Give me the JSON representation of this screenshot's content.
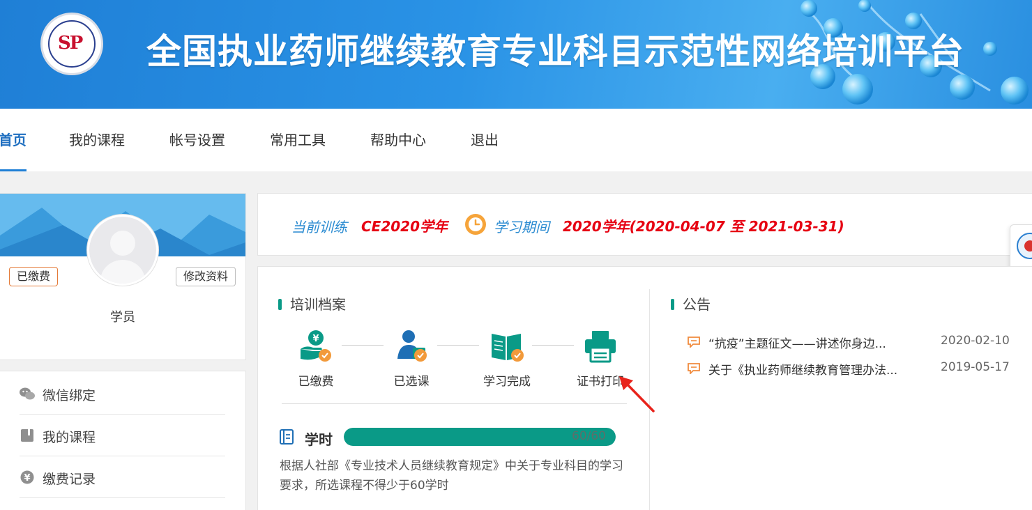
{
  "header": {
    "site_title": "全国执业药师继续教育专业科目示范性网络培训平台"
  },
  "nav": {
    "items": [
      "首页",
      "我的课程",
      "帐号设置",
      "常用工具",
      "帮助中心",
      "退出"
    ],
    "active_index": 0
  },
  "profile": {
    "status_tag": "已缴费",
    "edit_label": "修改资料",
    "role": "学员"
  },
  "side_menu": {
    "items": [
      {
        "label": "微信绑定",
        "icon": "wechat-icon"
      },
      {
        "label": "我的课程",
        "icon": "book-icon"
      },
      {
        "label": "缴费记录",
        "icon": "yen-icon"
      }
    ]
  },
  "current_training": {
    "label": "当前训练",
    "value": "CE2020学年",
    "period_label": "学习期间",
    "period_value": "2020学年(2020-04-07 至 2021-03-31)"
  },
  "training_record": {
    "title": "培训档案",
    "steps": [
      {
        "label": "已缴费",
        "icon": "paid-icon"
      },
      {
        "label": "已选课",
        "icon": "selected-course-icon"
      },
      {
        "label": "学习完成",
        "icon": "study-complete-icon"
      },
      {
        "label": "证书打印",
        "icon": "printer-icon"
      }
    ],
    "hours_label": "学时",
    "hours_text": "60/60",
    "hours_done": 60,
    "hours_total": 60,
    "description": "根据人社部《专业技术人员继续教育规定》中关于专业科目的学习要求，所选课程不得少于60学时"
  },
  "announcements": {
    "title": "公告",
    "items": [
      {
        "title": "“抗疫”主题征文——讲述你身边...",
        "date": "2020-02-10"
      },
      {
        "title": "关于《执业药师继续教育管理办法...",
        "date": "2019-05-17"
      }
    ]
  },
  "colors": {
    "brand_blue": "#1f7fd6",
    "accent_teal": "#0a9a87",
    "highlight_red": "#e60012"
  }
}
